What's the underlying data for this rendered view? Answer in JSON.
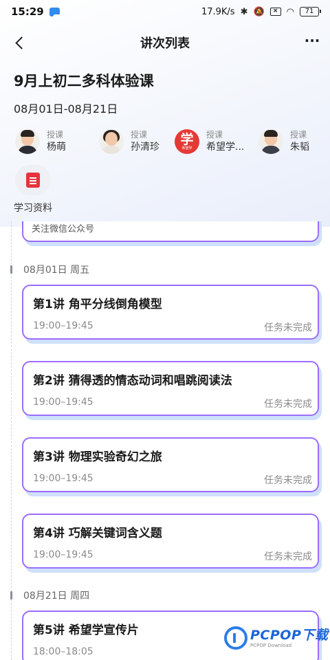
{
  "status_bar": {
    "time": "15:29",
    "network_speed": "17.9K/s",
    "battery": "71",
    "icons": [
      "bluetooth-icon",
      "mute-icon",
      "sim-x-icon",
      "wifi-icon",
      "battery-icon"
    ]
  },
  "nav": {
    "title": "讲次列表",
    "back_icon": "back-arrow-icon",
    "more_icon": "more-icon",
    "more_glyph": "···"
  },
  "course": {
    "title": "9月上初二多科体验课",
    "dates": "08月01日-08月21日"
  },
  "teachers": [
    {
      "role": "授课",
      "name": "杨萌"
    },
    {
      "role": "授课",
      "name": "孙清珍"
    },
    {
      "role": "授课",
      "name": "希望学...",
      "logo_char": "学",
      "logo_sub": "希望学"
    },
    {
      "role": "授课",
      "name": "朱韬"
    }
  ],
  "material": {
    "label": "学习资料"
  },
  "wechat_card": {
    "text": "关注微信公众号"
  },
  "groups": [
    {
      "date": "08月01日 周五",
      "lessons": [
        {
          "title": "第1讲 角平分线倒角模型",
          "time": "19:00–19:45",
          "status": "任务未完成"
        },
        {
          "title": "第2讲 猜得透的情态动词和唱跳阅读法",
          "time": "19:00–19:45",
          "status": "任务未完成"
        },
        {
          "title": "第3讲 物理实验奇幻之旅",
          "time": "19:00–19:45",
          "status": "任务未完成"
        },
        {
          "title": "第4讲 巧解关键词含义题",
          "time": "19:00–19:45",
          "status": "任务未完成"
        }
      ]
    },
    {
      "date": "08月21日 周四",
      "lessons": [
        {
          "title": "第5讲 希望学宣传片",
          "time": "18:00–18:05",
          "status": ""
        }
      ]
    }
  ],
  "watermark": {
    "brand": "PCPOP下载",
    "sub": "PCPOP Download"
  },
  "colors": {
    "card_border": "#9b6cff",
    "card_shadow": "#cfe0fb",
    "doc_icon": "#e8333c",
    "logo_red": "#e53935",
    "watermark_blue": "#1c64d8"
  }
}
